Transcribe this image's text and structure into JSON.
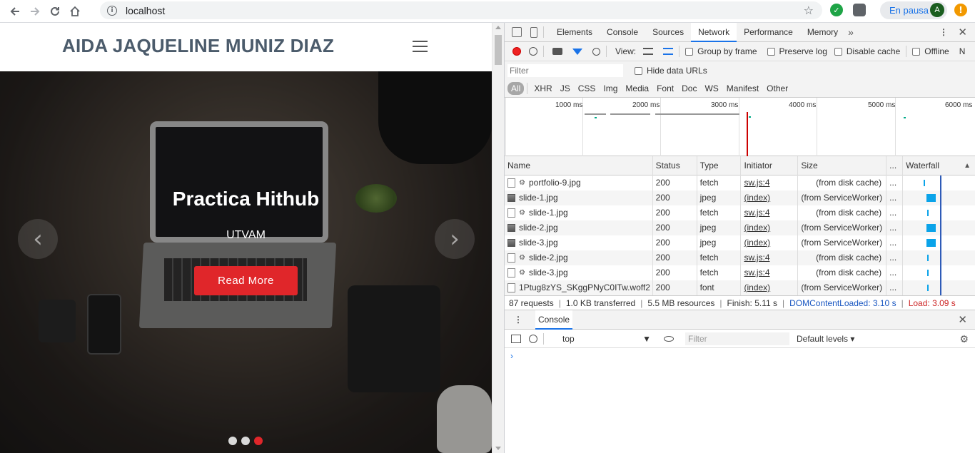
{
  "browser": {
    "url": "localhost",
    "pause_label": "En pausa",
    "avatar_letter": "A",
    "alert_glyph": "!"
  },
  "site": {
    "title": "AIDA JAQUELINE MUNIZ DIAZ",
    "slide_title": "Practica Hithub",
    "slide_subtitle": "UTVAM",
    "read_more": "Read More",
    "prev_glyph": "‹",
    "next_glyph": "›",
    "active_slide": 3,
    "slide_count": 3
  },
  "devtools": {
    "tabs": [
      "Elements",
      "Console",
      "Sources",
      "Network",
      "Performance",
      "Memory"
    ],
    "active_tab": "Network",
    "more_glyph": "»",
    "toolbar": {
      "view_label": "View:",
      "group_by_frame": "Group by frame",
      "preserve_log": "Preserve log",
      "disable_cache": "Disable cache",
      "offline": "Offline",
      "cutoff": "N"
    },
    "filter_placeholder": "Filter",
    "hide_data_urls": "Hide data URLs",
    "types": [
      "All",
      "XHR",
      "JS",
      "CSS",
      "Img",
      "Media",
      "Font",
      "Doc",
      "WS",
      "Manifest",
      "Other"
    ],
    "timeline_ticks": [
      "1000 ms",
      "2000 ms",
      "3000 ms",
      "4000 ms",
      "5000 ms",
      "6000 ms"
    ],
    "columns": {
      "name": "Name",
      "status": "Status",
      "type": "Type",
      "initiator": "Initiator",
      "size": "Size",
      "time": "...",
      "waterfall": "Waterfall"
    },
    "rows": [
      {
        "name": "portfolio-9.jpg",
        "icon": "gear",
        "status": "200",
        "type": "fetch",
        "initiator": "sw.js:4",
        "size": "(from disk cache)",
        "wf": "thin"
      },
      {
        "name": "slide-1.jpg",
        "icon": "img",
        "status": "200",
        "type": "jpeg",
        "initiator": "(index)",
        "size": "(from ServiceWorker)",
        "wf": "bar"
      },
      {
        "name": "slide-1.jpg",
        "icon": "gear",
        "status": "200",
        "type": "fetch",
        "initiator": "sw.js:4",
        "size": "(from disk cache)",
        "wf": "thin"
      },
      {
        "name": "slide-2.jpg",
        "icon": "img",
        "status": "200",
        "type": "jpeg",
        "initiator": "(index)",
        "size": "(from ServiceWorker)",
        "wf": "bar"
      },
      {
        "name": "slide-3.jpg",
        "icon": "img",
        "status": "200",
        "type": "jpeg",
        "initiator": "(index)",
        "size": "(from ServiceWorker)",
        "wf": "bar"
      },
      {
        "name": "slide-2.jpg",
        "icon": "gear",
        "status": "200",
        "type": "fetch",
        "initiator": "sw.js:4",
        "size": "(from disk cache)",
        "wf": "thin"
      },
      {
        "name": "slide-3.jpg",
        "icon": "gear",
        "status": "200",
        "type": "fetch",
        "initiator": "sw.js:4",
        "size": "(from disk cache)",
        "wf": "thin"
      },
      {
        "name": "1Ptug8zYS_SKggPNyC0ITw.woff2",
        "icon": "file",
        "status": "200",
        "type": "font",
        "initiator": "(index)",
        "size": "(from ServiceWorker)",
        "wf": "thin"
      }
    ],
    "summary": {
      "requests": "87 requests",
      "transferred": "1.0 KB transferred",
      "resources": "5.5 MB resources",
      "finish": "Finish: 5.11 s",
      "dcl": "DOMContentLoaded: 3.10 s",
      "load": "Load: 3.09 s"
    },
    "drawer": {
      "tab": "Console",
      "context": "top",
      "filter_placeholder": "Filter",
      "levels": "Default levels",
      "prompt": "›"
    }
  }
}
